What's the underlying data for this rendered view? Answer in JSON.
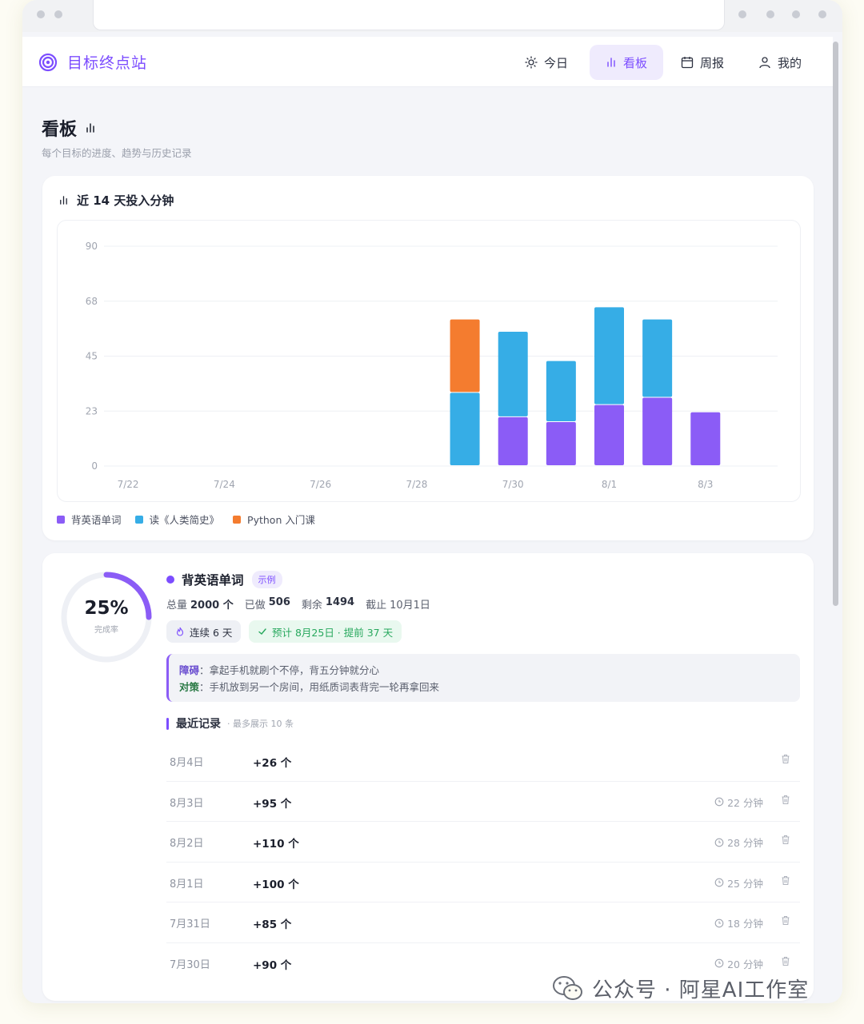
{
  "nav": {
    "brand": "目标终点站",
    "items": [
      {
        "label": "今日",
        "icon": "sun-icon"
      },
      {
        "label": "看板",
        "icon": "bar-chart-icon",
        "active": true
      },
      {
        "label": "周报",
        "icon": "calendar-icon"
      },
      {
        "label": "我的",
        "icon": "user-icon"
      }
    ]
  },
  "page": {
    "title": "看板",
    "subtitle": "每个目标的进度、趋势与历史记录"
  },
  "chart_card": {
    "title": "近 14 天投入分钟"
  },
  "chart_data": {
    "type": "bar",
    "stacked": true,
    "title": "近 14 天投入分钟",
    "categories": [
      "7/22",
      "7/23",
      "7/24",
      "7/25",
      "7/26",
      "7/27",
      "7/28",
      "7/29",
      "7/30",
      "7/31",
      "8/1",
      "8/2",
      "8/3",
      "8/4"
    ],
    "x_tick_labels": [
      "7/22",
      "7/24",
      "7/26",
      "7/28",
      "7/30",
      "8/1",
      "8/3"
    ],
    "y_ticks": [
      "0",
      "23",
      "45",
      "68",
      "90"
    ],
    "ylim": [
      0,
      90
    ],
    "grid": true,
    "legend_position": "bottom-left",
    "series": [
      {
        "name": "背英语单词",
        "color": "#8b5cf6",
        "values": [
          0,
          0,
          0,
          0,
          0,
          0,
          0,
          0,
          20,
          18,
          25,
          28,
          22,
          0
        ]
      },
      {
        "name": "读《人类简史》",
        "color": "#36ade6",
        "values": [
          0,
          0,
          0,
          0,
          0,
          0,
          0,
          30,
          35,
          25,
          40,
          32,
          0,
          0
        ]
      },
      {
        "name": "Python 入门课",
        "color": "#f47c2f",
        "values": [
          0,
          0,
          0,
          0,
          0,
          0,
          0,
          30,
          0,
          0,
          0,
          0,
          0,
          0
        ]
      }
    ]
  },
  "goal": {
    "name": "背英语单词",
    "tag": "示例",
    "color": "#7c4dff",
    "percent": 0.25,
    "percent_label": "25%",
    "percent_caption": "完成率",
    "stats": [
      {
        "k": "总量",
        "v": "2000 个"
      },
      {
        "k": "已做",
        "v": "506"
      },
      {
        "k": "剩余",
        "v": "1494"
      },
      {
        "k": "截止",
        "v": "10月1日"
      }
    ],
    "streak": "连续 6 天",
    "forecast": "预计 8月25日 · 提前 37 天",
    "obstacle_label": "障碍",
    "obstacle": "拿起手机就刷个不停，背五分钟就分心",
    "plan_label": "对策",
    "plan": "手机放到另一个房间，用纸质词表背完一轮再拿回来",
    "recent_title": "最近记录",
    "recent_sub": "· 最多展示 10 条",
    "records": [
      {
        "date": "8月4日",
        "value": "+26 个",
        "minutes": ""
      },
      {
        "date": "8月3日",
        "value": "+95 个",
        "minutes": "22 分钟"
      },
      {
        "date": "8月2日",
        "value": "+110 个",
        "minutes": "28 分钟"
      },
      {
        "date": "8月1日",
        "value": "+100 个",
        "minutes": "25 分钟"
      },
      {
        "date": "7月31日",
        "value": "+85 个",
        "minutes": "18 分钟"
      },
      {
        "date": "7月30日",
        "value": "+90 个",
        "minutes": "20 分钟"
      }
    ]
  },
  "watermark": "公众号 · 阿星AI工作室"
}
